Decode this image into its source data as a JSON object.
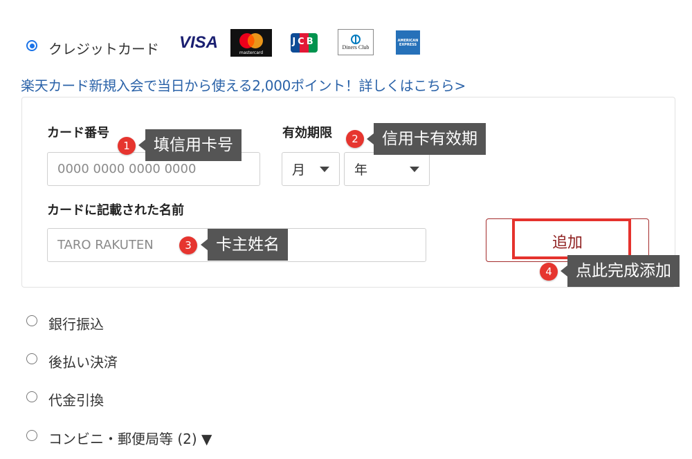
{
  "payment": {
    "credit_card_label": "クレジットカード",
    "card_brands": [
      {
        "name": "VISA",
        "text": "VISA"
      },
      {
        "name": "Mastercard",
        "text": "mastercard"
      },
      {
        "name": "JCB",
        "text": "JCB"
      },
      {
        "name": "Diners Club",
        "text": "Diners Club"
      },
      {
        "name": "American Express",
        "text": "AMERICAN EXPRESS"
      }
    ],
    "promo_link": "楽天カード新規入会で当日から使える2,000ポイント！詳しくはこちら>",
    "card_form": {
      "card_number_label": "カード番号",
      "card_number_placeholder": "0000 0000 0000 0000",
      "expiry_label": "有効期限",
      "month_value": "月",
      "year_value": "年",
      "name_label": "カードに記載された名前",
      "name_placeholder": "TARO RAKUTEN",
      "add_button": "追加"
    },
    "other_methods": [
      {
        "label": "銀行振込"
      },
      {
        "label": "後払い決済"
      },
      {
        "label": "代金引換"
      },
      {
        "label": "コンビニ・郵便局等 (2) ▼"
      }
    ]
  },
  "annotations": [
    {
      "number": "1",
      "text": "填信用卡号"
    },
    {
      "number": "2",
      "text": "信用卡有效期"
    },
    {
      "number": "3",
      "text": "卡主姓名"
    },
    {
      "number": "4",
      "text": "点此完成添加"
    }
  ],
  "colors": {
    "accent": "#1a73e8",
    "link": "#2a62a8",
    "button_text": "#8e1f1f",
    "annotation_red": "#e5322d",
    "tooltip_bg": "#555555"
  }
}
